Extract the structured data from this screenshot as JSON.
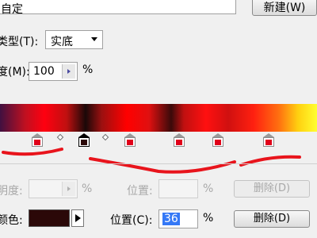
{
  "name_field": {
    "value": "自定"
  },
  "new_button": {
    "label": "新建(W)"
  },
  "gradient_type": {
    "label": "类型(T):",
    "value": "实底"
  },
  "smoothness": {
    "label": "度(M):",
    "value": "100",
    "unit": "%"
  },
  "opacity_row": {
    "label": "明度:",
    "unit": "%",
    "location_label": "位置:",
    "location_unit": "%",
    "delete_label": "删除(D)"
  },
  "color_row": {
    "label": "颜色:",
    "location_label": "位置(C):",
    "location_value": "36",
    "unit": "%",
    "delete_label": "删除(D)"
  },
  "colors": {
    "accent_red": "#e0001a",
    "selected_stop": "#2b0808",
    "annotation": "#e8141c"
  }
}
